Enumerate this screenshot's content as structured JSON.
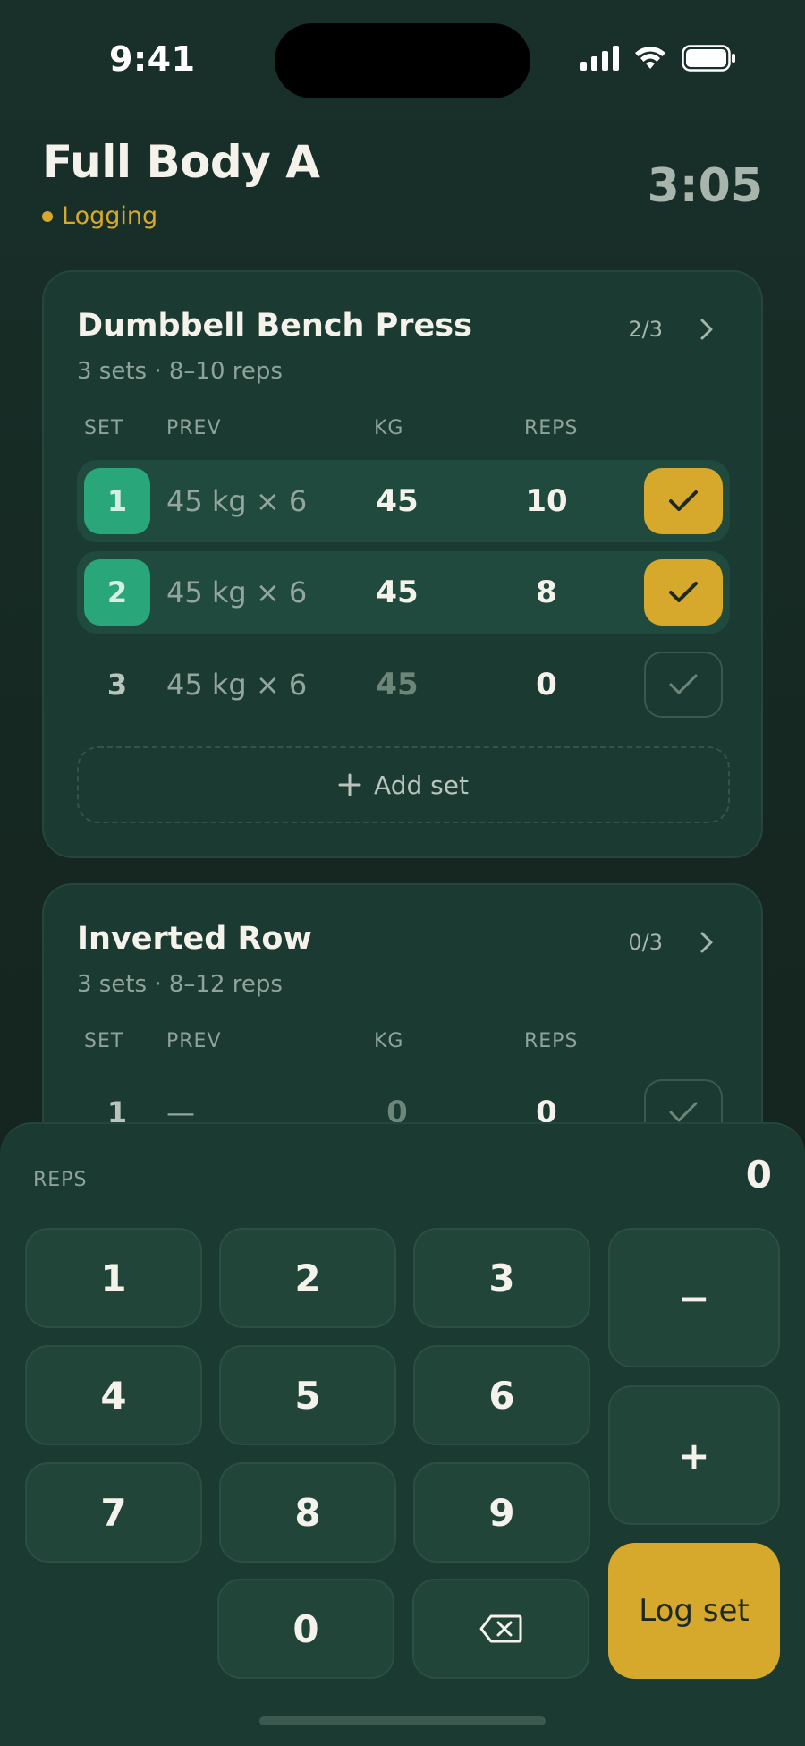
{
  "status_bar": {
    "time": "9:41"
  },
  "header": {
    "title": "Full Body A",
    "status": "Logging",
    "elapsed": "3:05"
  },
  "colors": {
    "accent": "#d6a92c",
    "done_badge": "#29a77b",
    "card_bg": "#1b3a31"
  },
  "exercises": [
    {
      "name": "Dumbbell Bench Press",
      "subtitle": "3 sets · 8–10 reps",
      "progress": "2/3",
      "columns": [
        "SET",
        "PREV",
        "KG",
        "REPS"
      ],
      "sets": [
        {
          "set": "1",
          "prev": "45 kg × 6",
          "kg": "45",
          "reps": "10",
          "done": true
        },
        {
          "set": "2",
          "prev": "45 kg × 6",
          "kg": "45",
          "reps": "8",
          "done": true
        },
        {
          "set": "3",
          "prev": "45 kg × 6",
          "kg": "45",
          "reps": "0",
          "done": false
        }
      ],
      "add_set_label": "Add set"
    },
    {
      "name": "Inverted Row",
      "subtitle": "3 sets · 8–12 reps",
      "progress": "0/3",
      "columns": [
        "SET",
        "PREV",
        "KG",
        "REPS"
      ],
      "sets": [
        {
          "set": "1",
          "prev": "—",
          "kg": "0",
          "reps": "0",
          "done": false
        }
      ]
    }
  ],
  "keypad": {
    "label": "REPS",
    "value": "0",
    "keys": [
      "1",
      "2",
      "3",
      "4",
      "5",
      "6",
      "7",
      "8",
      "9",
      "0"
    ],
    "minus_label": "−",
    "plus_label": "+",
    "backspace_icon": "backspace-icon",
    "log_label": "Log set"
  }
}
